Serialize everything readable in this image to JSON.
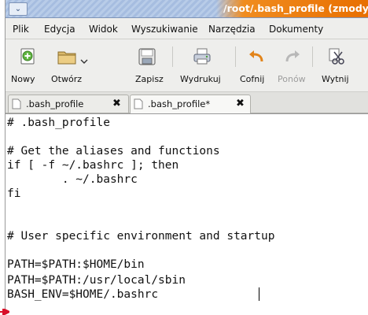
{
  "window": {
    "title": "/root/.bash_profile (zmodyfikowany)",
    "window_menu_icon": "chevron-down-icon",
    "title_accent_color": "#e86f00"
  },
  "menu": {
    "items": [
      {
        "label": "Plik"
      },
      {
        "label": "Edycja"
      },
      {
        "label": "Widok"
      },
      {
        "label": "Wyszukiwanie"
      },
      {
        "label": "Narzędzia"
      },
      {
        "label": "Dokumenty"
      }
    ]
  },
  "toolbar": {
    "buttons": [
      {
        "label": "Nowy",
        "icon": "new-document-icon",
        "enabled": true
      },
      {
        "label": "Otwórz",
        "icon": "open-folder-icon",
        "enabled": true
      },
      {
        "label": "Zapisz",
        "icon": "save-icon",
        "enabled": true
      },
      {
        "label": "Wydrukuj",
        "icon": "print-icon",
        "enabled": true
      },
      {
        "label": "Cofnij",
        "icon": "undo-icon",
        "enabled": true
      },
      {
        "label": "Ponów",
        "icon": "redo-icon",
        "enabled": false
      },
      {
        "label": "Wytnij",
        "icon": "cut-icon",
        "enabled": true
      }
    ]
  },
  "tabs": [
    {
      "label": ".bash_profile",
      "active": false
    },
    {
      "label": ".bash_profile*",
      "active": true
    }
  ],
  "editor": {
    "lines": [
      "# .bash_profile",
      "",
      "# Get the aliases and functions",
      "if [ -f ~/.bashrc ]; then",
      "        . ~/.bashrc",
      "fi",
      "",
      "# User specific environment and startup",
      "",
      "PATH=$PATH:$HOME/bin",
      "PATH=$PATH:/usr/local/sbin",
      "BASH_ENV=$HOME/.bashrc"
    ]
  },
  "annotation": {
    "arrow_color": "#d8102a"
  }
}
